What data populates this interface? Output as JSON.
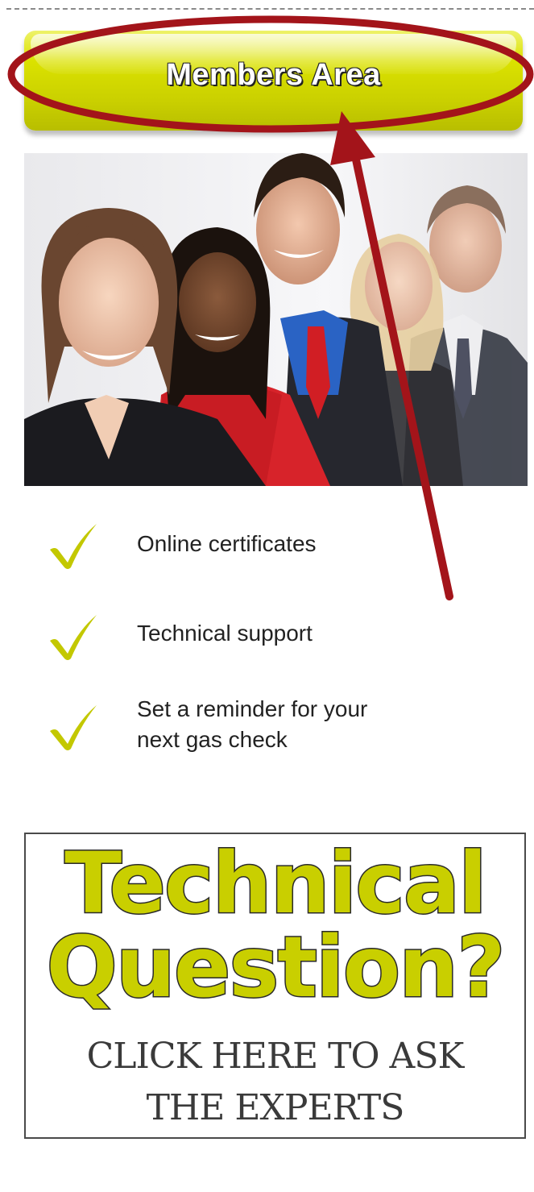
{
  "members_button": {
    "label": "Members Area"
  },
  "photo": {
    "alt": "Group of smiling business people in suits"
  },
  "features": [
    {
      "icon": "checkmark-icon",
      "text": "Online certificates"
    },
    {
      "icon": "checkmark-icon",
      "text": "Technical support"
    },
    {
      "icon": "checkmark-icon",
      "text": "Set a reminder for your next gas check"
    }
  ],
  "ask_banner": {
    "headline_1": "Technical",
    "headline_2": "Question?",
    "cta_1": "CLICK HERE TO ASK",
    "cta_2": "THE EXPERTS"
  },
  "colors": {
    "accent_yellow": "#cad000",
    "annotation_red": "#a3141a",
    "check_yellow": "#c3c800"
  }
}
